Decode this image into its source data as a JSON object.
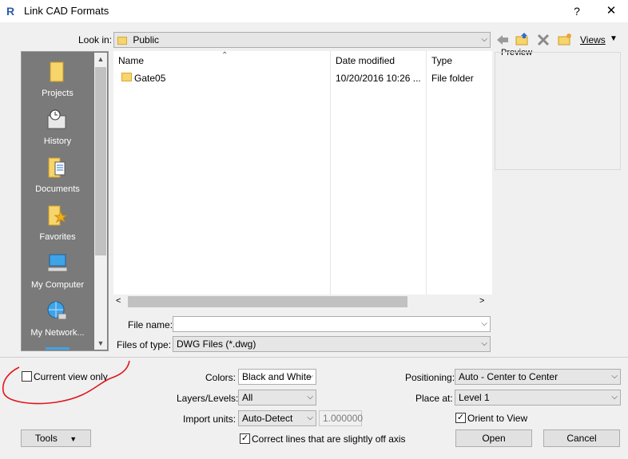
{
  "window": {
    "title": "Link CAD Formats",
    "help": "?",
    "close": "✕"
  },
  "lookin": {
    "label": "Look in:",
    "value": "Public"
  },
  "toolbar": {
    "views_label": "Views"
  },
  "preview": {
    "label": "Preview"
  },
  "places": [
    {
      "label": "Projects"
    },
    {
      "label": "History"
    },
    {
      "label": "Documents"
    },
    {
      "label": "Favorites"
    },
    {
      "label": "My Computer"
    },
    {
      "label": "My Network..."
    }
  ],
  "filelist": {
    "columns": [
      "Name",
      "Date modified",
      "Type"
    ],
    "rows": [
      {
        "name": "Gate05",
        "date": "10/20/2016 10:26 ...",
        "type": "File folder"
      }
    ]
  },
  "filename": {
    "label": "File name:",
    "value": ""
  },
  "filetype": {
    "label": "Files of type:",
    "value": "DWG Files  (*.dwg)"
  },
  "options": {
    "current_view_only": "Current view only",
    "colors_label": "Colors:",
    "colors_value": "Black and White",
    "layers_label": "Layers/Levels:",
    "layers_value": "All",
    "units_label": "Import units:",
    "units_value": "Auto-Detect",
    "units_factor": "1.000000",
    "correct_lines": "Correct lines that are slightly off axis",
    "positioning_label": "Positioning:",
    "positioning_value": "Auto - Center to Center",
    "place_at_label": "Place at:",
    "place_at_value": "Level 1",
    "orient_to_view": "Orient to View"
  },
  "buttons": {
    "tools": "Tools",
    "open": "Open",
    "cancel": "Cancel"
  },
  "colors": {
    "annotation_red": "#e0161b",
    "folder_yellow": "#f7d56a"
  }
}
